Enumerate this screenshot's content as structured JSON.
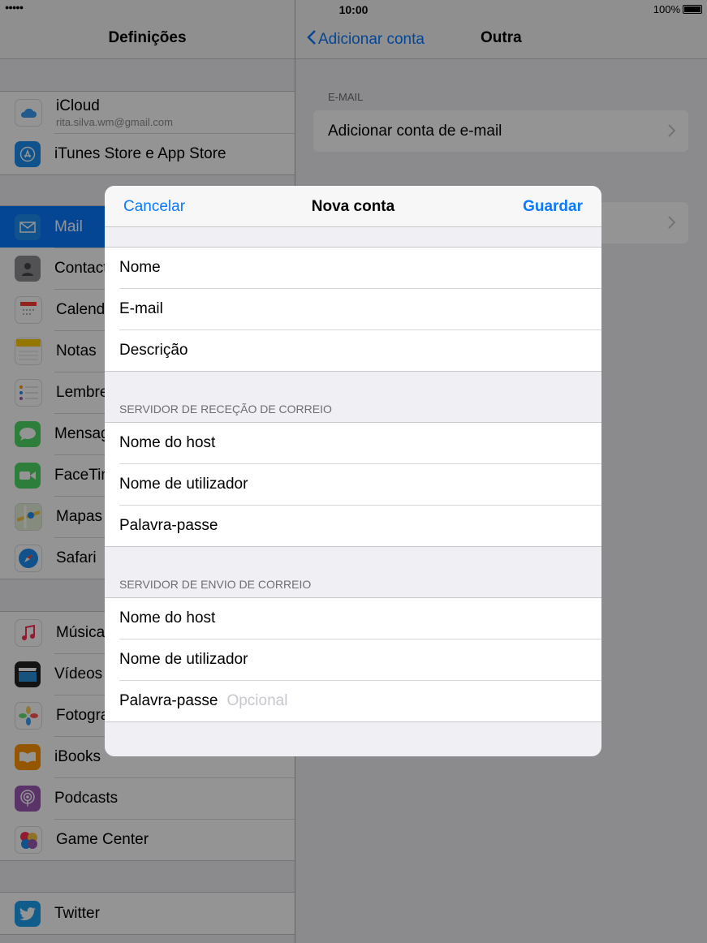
{
  "status_bar": {
    "signal": "●●●●●",
    "time": "10:00",
    "battery": "100%"
  },
  "sidebar": {
    "title": "Definições",
    "group1": [
      {
        "label": "iCloud",
        "sub": "rita.silva.wm@gmail.com",
        "icon": "cloud-icon",
        "color": "#ffffff"
      },
      {
        "label": "iTunes Store e App Store",
        "icon": "app-store-icon",
        "color": "#1b8df2"
      }
    ],
    "group2": [
      {
        "label": "Mail",
        "icon": "mail-icon",
        "color": "#1b8df2"
      },
      {
        "label": "Contactos",
        "icon": "contacts-icon",
        "color": "#8e8e93"
      },
      {
        "label": "Calendário",
        "icon": "calendar-icon",
        "color": "#ffffff"
      },
      {
        "label": "Notas",
        "icon": "notes-icon",
        "color": "#ffcc00"
      },
      {
        "label": "Lembretes",
        "icon": "reminders-icon",
        "color": "#ffffff"
      },
      {
        "label": "Mensagens",
        "icon": "messages-icon",
        "color": "#4cd964"
      },
      {
        "label": "FaceTime",
        "icon": "facetime-icon",
        "color": "#4cd964"
      },
      {
        "label": "Mapas",
        "icon": "maps-icon",
        "color": "#8fd06a"
      },
      {
        "label": "Safari",
        "icon": "safari-icon",
        "color": "#1b8df2"
      }
    ],
    "group3": [
      {
        "label": "Música",
        "icon": "music-icon",
        "color": "#ffffff"
      },
      {
        "label": "Vídeos",
        "icon": "videos-icon",
        "color": "#222222"
      },
      {
        "label": "Fotografias",
        "icon": "photos-icon",
        "color": "#ffffff"
      },
      {
        "label": "iBooks",
        "icon": "ibooks-icon",
        "color": "#ff9500"
      },
      {
        "label": "Podcasts",
        "icon": "podcasts-icon",
        "color": "#9b59b6"
      },
      {
        "label": "Game Center",
        "icon": "game-center-icon",
        "color": "#ffffff"
      }
    ],
    "group4": [
      {
        "label": "Twitter",
        "icon": "twitter-icon",
        "color": "#1da1f2"
      }
    ]
  },
  "detail": {
    "back_label": "Adicionar conta",
    "title": "Outra",
    "email_section": "E-MAIL",
    "add_mail_account": "Adicionar conta de e-mail"
  },
  "modal": {
    "cancel": "Cancelar",
    "title": "Nova conta",
    "save": "Guardar",
    "fields": [
      "Nome",
      "E-mail",
      "Descrição"
    ],
    "incoming_header": "SERVIDOR DE RECEÇÃO DE CORREIO",
    "incoming_fields": [
      "Nome do host",
      "Nome de utilizador",
      "Palavra-passe"
    ],
    "outgoing_header": "SERVIDOR DE ENVIO DE CORREIO",
    "outgoing_fields": [
      "Nome do host",
      "Nome de utilizador",
      "Palavra-passe"
    ],
    "outgoing_password_placeholder": "Opcional"
  }
}
